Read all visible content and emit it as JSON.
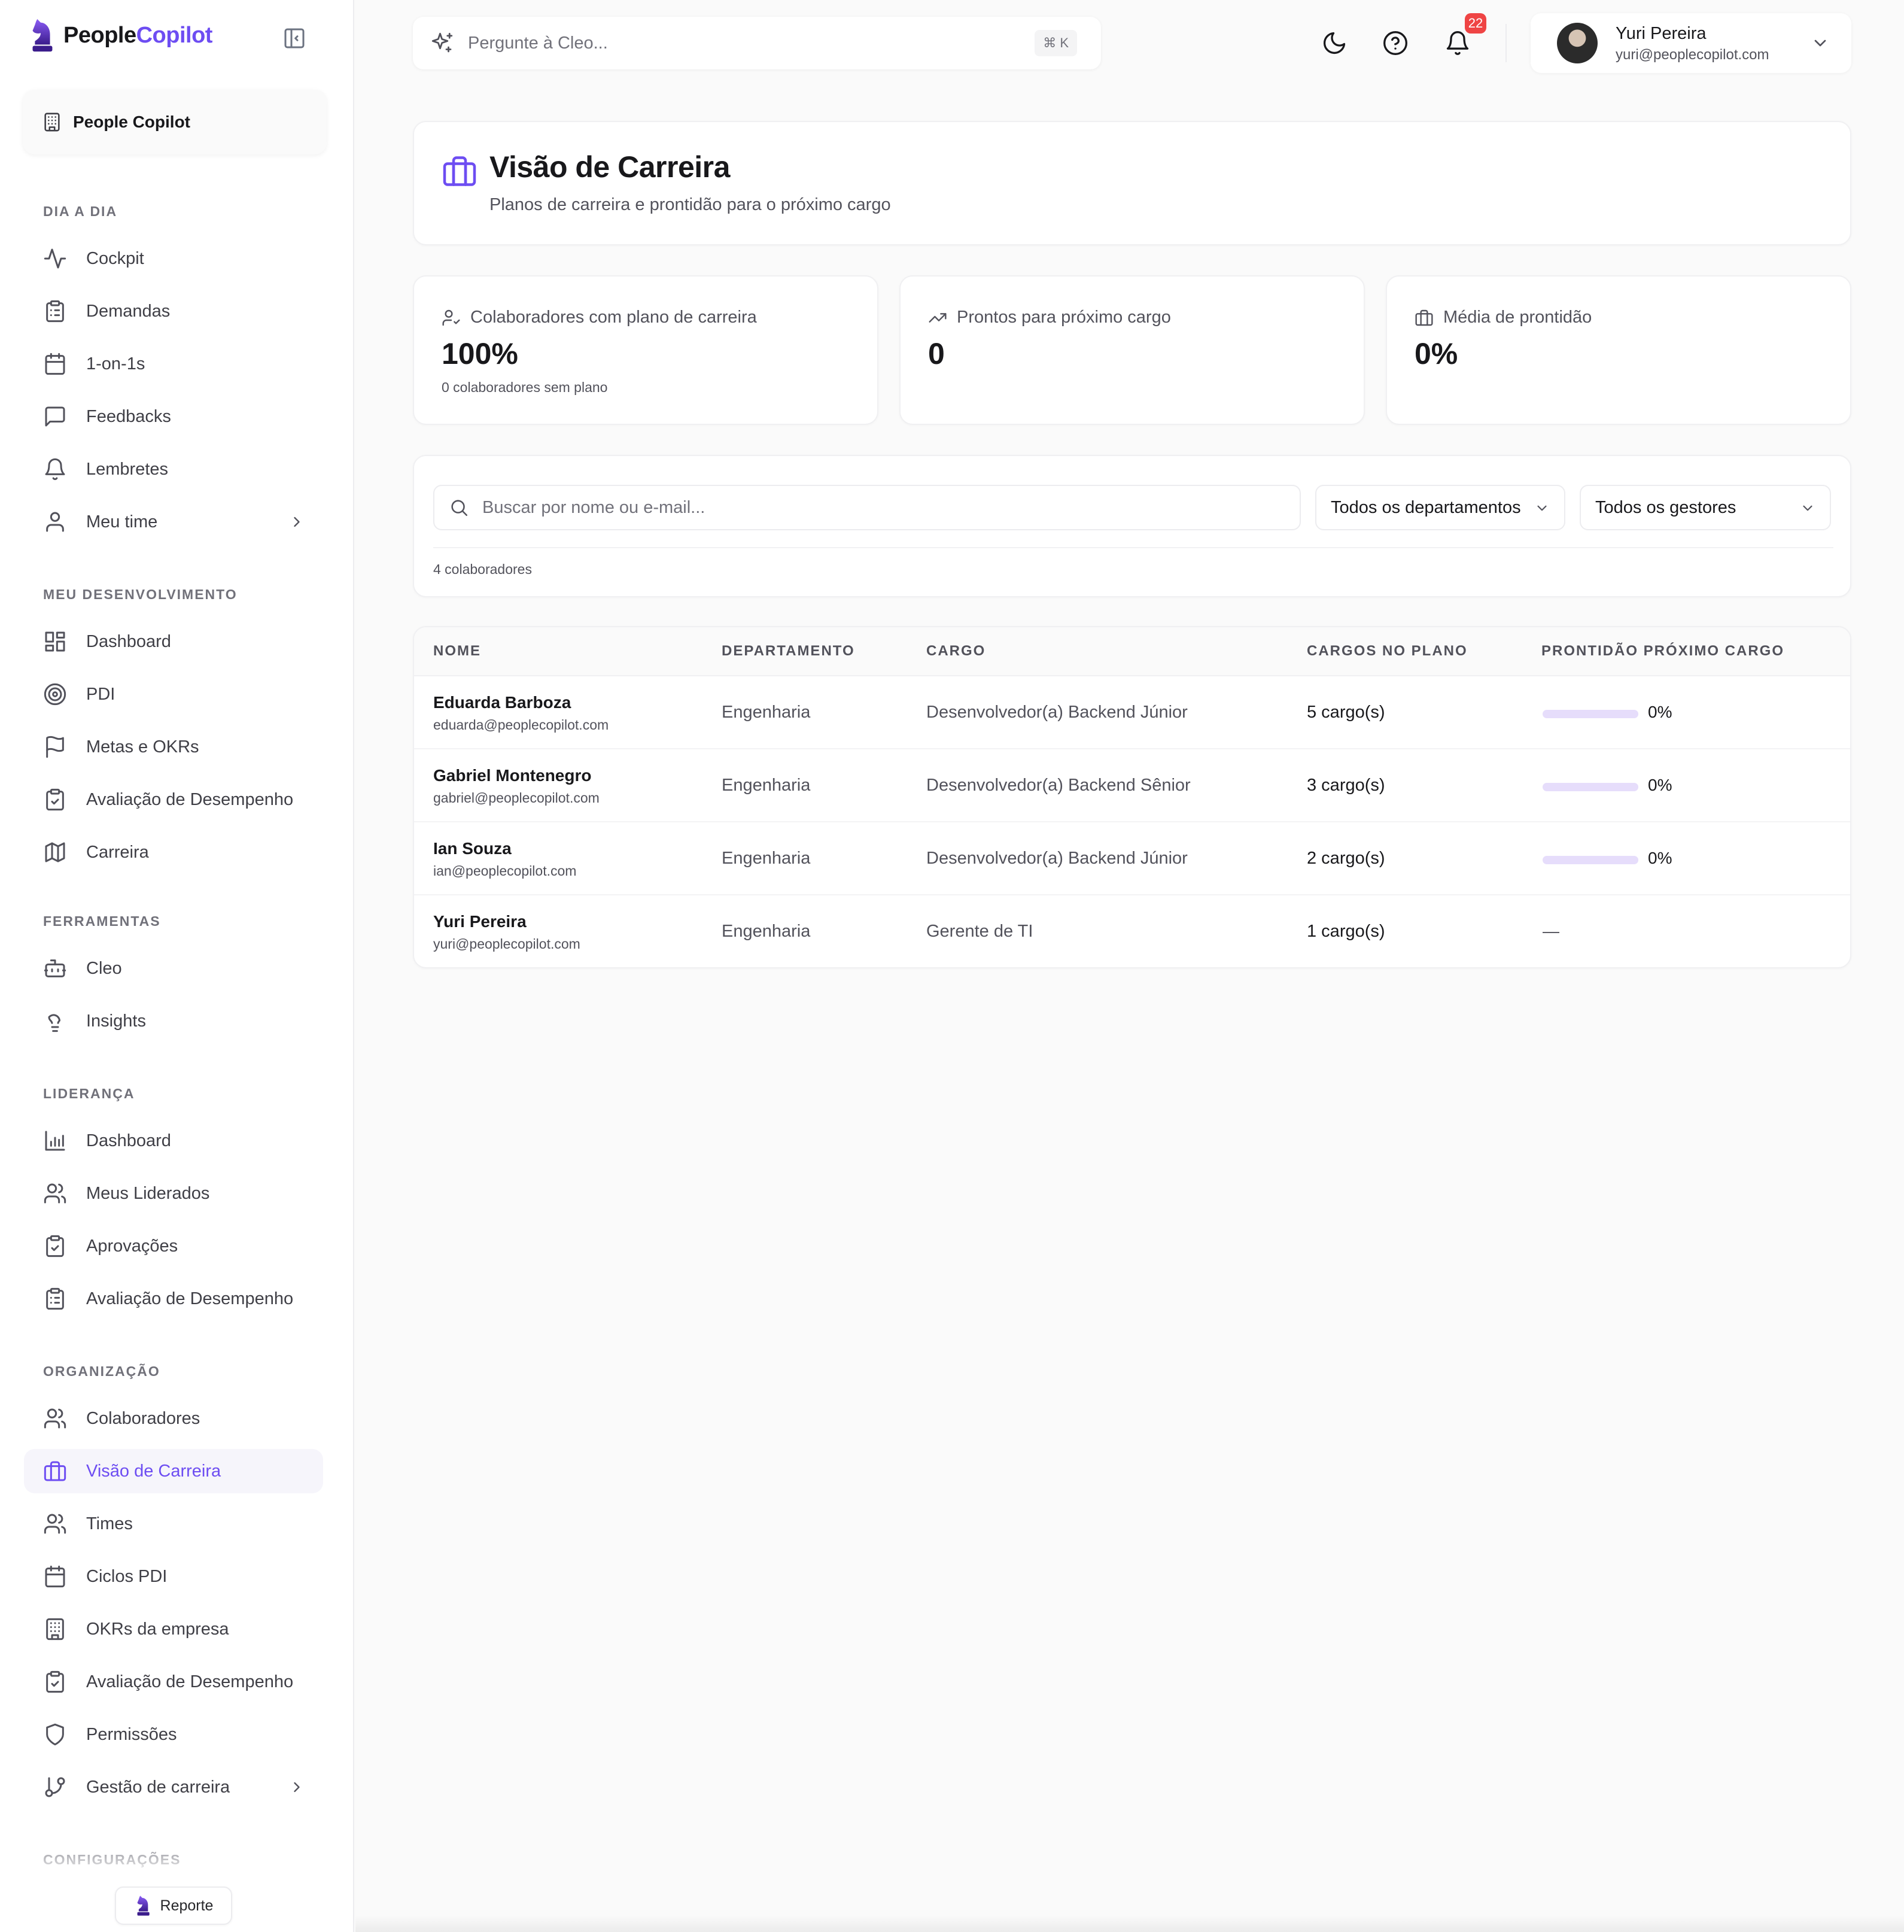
{
  "brand": {
    "name_part1": "People",
    "name_part2": "Copilot"
  },
  "org": {
    "name": "People Copilot"
  },
  "sidebar": {
    "sections": [
      {
        "title": "DIA A DIA",
        "items": [
          {
            "label": "Cockpit",
            "icon": "activity-icon"
          },
          {
            "label": "Demandas",
            "icon": "clipboard-list-icon"
          },
          {
            "label": "1-on-1s",
            "icon": "calendar-icon"
          },
          {
            "label": "Feedbacks",
            "icon": "message-square-icon"
          },
          {
            "label": "Lembretes",
            "icon": "bell-icon"
          },
          {
            "label": "Meu time",
            "icon": "user-icon",
            "has_chevron": true
          }
        ]
      },
      {
        "title": "MEU DESENVOLVIMENTO",
        "items": [
          {
            "label": "Dashboard",
            "icon": "layout-dashboard-icon"
          },
          {
            "label": "PDI",
            "icon": "target-icon"
          },
          {
            "label": "Metas e OKRs",
            "icon": "flag-icon"
          },
          {
            "label": "Avaliação de Desempenho",
            "icon": "clipboard-check-icon"
          },
          {
            "label": "Carreira",
            "icon": "map-icon"
          }
        ]
      },
      {
        "title": "FERRAMENTAS",
        "items": [
          {
            "label": "Cleo",
            "icon": "bot-icon"
          },
          {
            "label": "Insights",
            "icon": "lightbulb-icon"
          }
        ]
      },
      {
        "title": "LIDERANÇA",
        "items": [
          {
            "label": "Dashboard",
            "icon": "bar-chart-icon"
          },
          {
            "label": "Meus Liderados",
            "icon": "users-icon"
          },
          {
            "label": "Aprovações",
            "icon": "clipboard-check-icon"
          },
          {
            "label": "Avaliação de Desempenho",
            "icon": "clipboard-list-icon"
          }
        ]
      },
      {
        "title": "ORGANIZAÇÃO",
        "items": [
          {
            "label": "Colaboradores",
            "icon": "users-icon"
          },
          {
            "label": "Visão de Carreira",
            "icon": "briefcase-icon",
            "active": true
          },
          {
            "label": "Times",
            "icon": "users-icon"
          },
          {
            "label": "Ciclos PDI",
            "icon": "calendar-icon"
          },
          {
            "label": "OKRs da empresa",
            "icon": "building-icon"
          },
          {
            "label": "Avaliação de Desempenho",
            "icon": "clipboard-check-icon"
          },
          {
            "label": "Permissões",
            "icon": "shield-icon"
          },
          {
            "label": "Gestão de carreira",
            "icon": "git-branch-icon",
            "has_chevron": true
          }
        ]
      },
      {
        "title": "CONFIGURAÇÕES",
        "items": []
      }
    ],
    "report_label": "Reporte"
  },
  "topbar": {
    "ask_placeholder": "Pergunte à Cleo...",
    "shortcut": "⌘ K",
    "notifications_count": "22",
    "user": {
      "name": "Yuri Pereira",
      "email": "yuri@peoplecopilot.com"
    }
  },
  "page": {
    "title": "Visão de Carreira",
    "subtitle": "Planos de carreira e prontidão para o próximo cargo"
  },
  "stats": [
    {
      "label": "Colaboradores com plano de carreira",
      "value": "100%",
      "note": "0 colaboradores sem plano",
      "icon": "user-check-icon"
    },
    {
      "label": "Prontos para próximo cargo",
      "value": "0",
      "note": "",
      "icon": "trending-up-icon"
    },
    {
      "label": "Média de prontidão",
      "value": "0%",
      "note": "",
      "icon": "briefcase-icon"
    }
  ],
  "filters": {
    "search_placeholder": "Buscar por nome ou e-mail...",
    "department": "Todos os departamentos",
    "manager": "Todos os gestores",
    "count": "4 colaboradores"
  },
  "table": {
    "columns": [
      "NOME",
      "DEPARTAMENTO",
      "CARGO",
      "CARGOS NO PLANO",
      "PRONTIDÃO PRÓXIMO CARGO"
    ],
    "rows": [
      {
        "name": "Eduarda Barboza",
        "email": "eduarda@peoplecopilot.com",
        "department": "Engenharia",
        "role": "Desenvolvedor(a) Backend Júnior",
        "plan": "5 cargo(s)",
        "readiness": "0%",
        "readiness_value": 0
      },
      {
        "name": "Gabriel Montenegro",
        "email": "gabriel@peoplecopilot.com",
        "department": "Engenharia",
        "role": "Desenvolvedor(a) Backend Sênior",
        "plan": "3 cargo(s)",
        "readiness": "0%",
        "readiness_value": 0
      },
      {
        "name": "Ian Souza",
        "email": "ian@peoplecopilot.com",
        "department": "Engenharia",
        "role": "Desenvolvedor(a) Backend Júnior",
        "plan": "2 cargo(s)",
        "readiness": "0%",
        "readiness_value": 0
      },
      {
        "name": "Yuri Pereira",
        "email": "yuri@peoplecopilot.com",
        "department": "Engenharia",
        "role": "Gerente de TI",
        "plan": "1 cargo(s)",
        "readiness": "—",
        "readiness_value": null
      }
    ]
  },
  "colors": {
    "accent": "#6d4df2",
    "progress_track": "#e6ddfb",
    "badge": "#ef4444"
  }
}
